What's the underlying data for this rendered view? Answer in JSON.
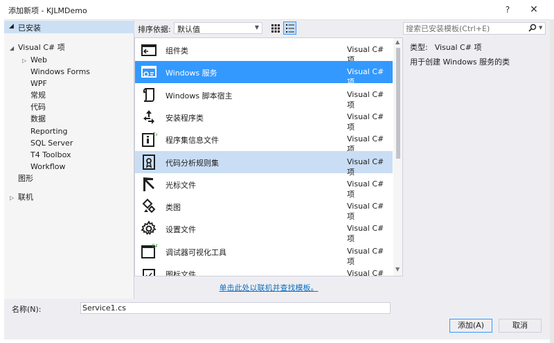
{
  "window": {
    "title": "添加新项 - KJLMDemo",
    "help": "?",
    "close": "✕"
  },
  "tree": {
    "header": "已安装",
    "items": [
      {
        "label": "Visual C# 项",
        "expander": "◢",
        "level": 1
      },
      {
        "label": "Web",
        "expander": "▷",
        "level": 2
      },
      {
        "label": "Windows Forms",
        "expander": "",
        "level": 2
      },
      {
        "label": "WPF",
        "expander": "",
        "level": 2
      },
      {
        "label": "常规",
        "expander": "",
        "level": 2
      },
      {
        "label": "代码",
        "expander": "",
        "level": 2
      },
      {
        "label": "数据",
        "expander": "",
        "level": 2
      },
      {
        "label": "Reporting",
        "expander": "",
        "level": 2
      },
      {
        "label": "SQL Server",
        "expander": "",
        "level": 2
      },
      {
        "label": "T4 Toolbox",
        "expander": "",
        "level": 2
      },
      {
        "label": "Workflow",
        "expander": "",
        "level": 2
      },
      {
        "label": "图形",
        "expander": "",
        "level": 1
      },
      {
        "label": "联机",
        "expander": "▷",
        "level": 0
      }
    ]
  },
  "toolbar": {
    "sort_label": "排序依据:",
    "sort_value": "默认值"
  },
  "list": {
    "items": [
      {
        "name": "组件类",
        "lang": "Visual C# 项",
        "icon": "component-icon",
        "state": ""
      },
      {
        "name": "Windows 服务",
        "lang": "Visual C# 项",
        "icon": "windows-service-icon",
        "state": "selected"
      },
      {
        "name": "Windows 脚本宿主",
        "lang": "Visual C# 项",
        "icon": "script-host-icon",
        "state": ""
      },
      {
        "name": "安装程序类",
        "lang": "Visual C# 项",
        "icon": "installer-icon",
        "state": ""
      },
      {
        "name": "程序集信息文件",
        "lang": "Visual C# 项",
        "icon": "assembly-info-icon",
        "state": ""
      },
      {
        "name": "代码分析规则集",
        "lang": "Visual C# 项",
        "icon": "ruleset-icon",
        "state": "hover"
      },
      {
        "name": "光标文件",
        "lang": "Visual C# 项",
        "icon": "cursor-icon",
        "state": ""
      },
      {
        "name": "类图",
        "lang": "Visual C# 项",
        "icon": "class-diagram-icon",
        "state": ""
      },
      {
        "name": "设置文件",
        "lang": "Visual C# 项",
        "icon": "settings-gear-icon",
        "state": ""
      },
      {
        "name": "调试器可视化工具",
        "lang": "Visual C# 项",
        "icon": "debugger-visualizer-icon",
        "state": ""
      },
      {
        "name": "图标文件",
        "lang": "Visual C# 项",
        "icon": "icon-file-icon",
        "state": ""
      }
    ]
  },
  "online_link": "单击此处以联机并查找模板。",
  "search": {
    "placeholder": "搜索已安装模板(Ctrl+E)"
  },
  "details": {
    "type_label": "类型:",
    "type_value": "Visual C# 项",
    "description": "用于创建 Windows 服务的类"
  },
  "name_field": {
    "label": "名称(N):",
    "value": "Service1.cs"
  },
  "buttons": {
    "ok": "添加(A)",
    "cancel": "取消"
  },
  "colors": {
    "accent": "#3399ff",
    "hover": "#c9def5",
    "link": "#0e70c0",
    "tree_header": "#cce0f5"
  }
}
